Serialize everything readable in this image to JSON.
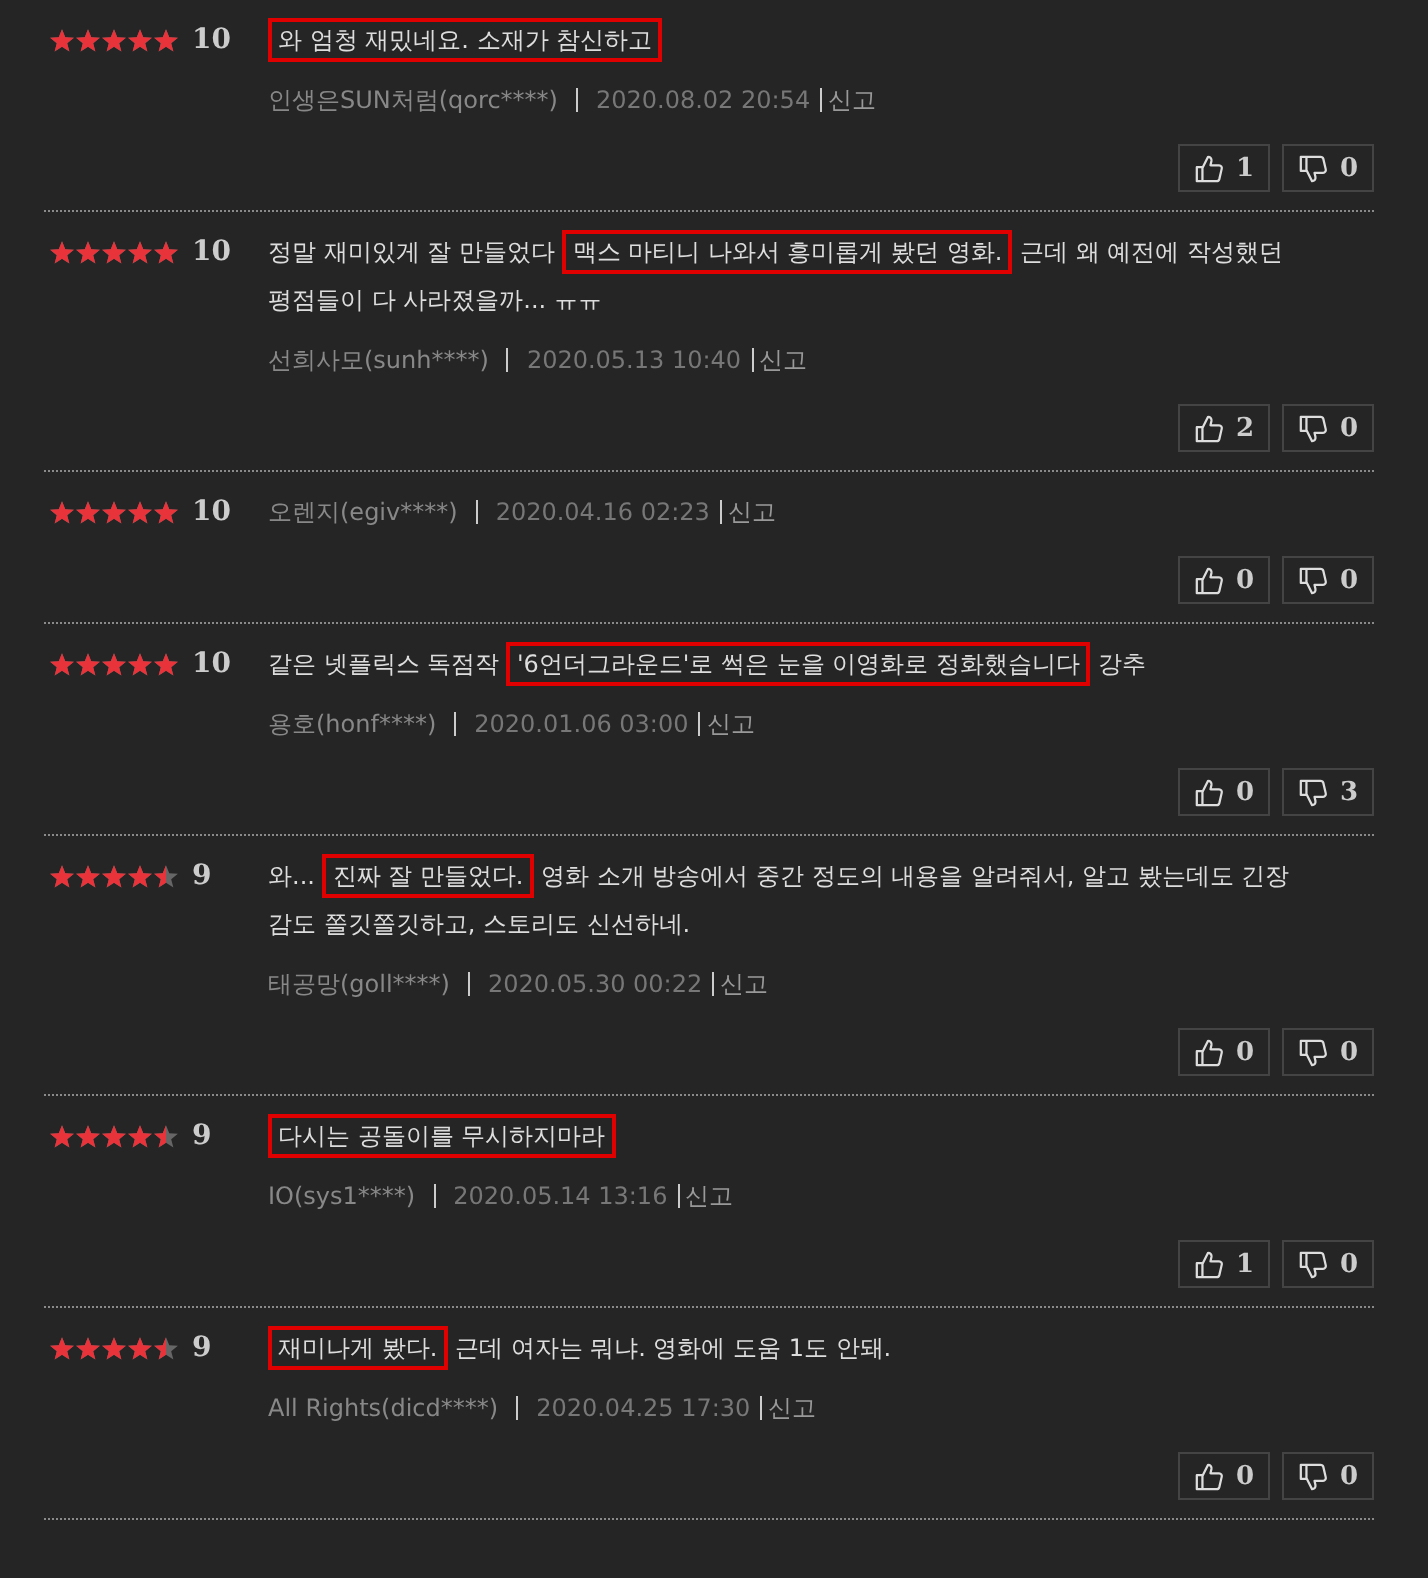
{
  "reviews": [
    {
      "stars": 5,
      "score": "10",
      "comment": [
        {
          "text": "와 엄청 재밌네요. 소재가 참신하고",
          "highlighted": true
        }
      ],
      "author": "인생은SUN처럼(qorc****)",
      "date": "2020.08.02 20:54",
      "report": "신고",
      "likes": "1",
      "dislikes": "0"
    },
    {
      "stars": 5,
      "score": "10",
      "comment": [
        {
          "text": "정말 재미있게 잘 만들었다 ",
          "highlighted": false
        },
        {
          "text": "맥스 마티니 나와서 흥미롭게 봤던 영화.",
          "highlighted": true
        },
        {
          "text": " 근데 왜 예전에 작성했던 평점들이 다 사라졌을까... ㅠㅠ",
          "highlighted": false
        }
      ],
      "author": "선희사모(sunh****)",
      "date": "2020.05.13 10:40",
      "report": "신고",
      "likes": "2",
      "dislikes": "0"
    },
    {
      "stars": 5,
      "score": "10",
      "author": "오렌지(egiv****)",
      "date": "2020.04.16 02:23",
      "report": "신고",
      "likes": "0",
      "dislikes": "0"
    },
    {
      "stars": 5,
      "score": "10",
      "comment": [
        {
          "text": "같은 넷플릭스 독점작 ",
          "highlighted": false
        },
        {
          "text": "'6언더그라운드'로 썩은 눈을 이영화로 정화했습니다",
          "highlighted": true
        },
        {
          "text": " 강추",
          "highlighted": false
        }
      ],
      "author": "용호(honf****)",
      "date": "2020.01.06 03:00",
      "report": "신고",
      "likes": "0",
      "dislikes": "3"
    },
    {
      "stars": 4.5,
      "score": "9",
      "comment": [
        {
          "text": "와... ",
          "highlighted": false
        },
        {
          "text": "진짜 잘 만들었다.",
          "highlighted": true
        },
        {
          "text": " 영화 소개 방송에서 중간 정도의 내용을 알려줘서, 알고 봤는데도 긴장감도 쫄깃쫄깃하고, 스토리도 신선하네.",
          "highlighted": false
        }
      ],
      "author": "태공망(goll****)",
      "date": "2020.05.30 00:22",
      "report": "신고",
      "likes": "0",
      "dislikes": "0"
    },
    {
      "stars": 4.5,
      "score": "9",
      "comment": [
        {
          "text": "다시는 공돌이를 무시하지마라",
          "highlighted": true
        }
      ],
      "author": "IO(sys1****)",
      "date": "2020.05.14 13:16",
      "report": "신고",
      "likes": "1",
      "dislikes": "0"
    },
    {
      "stars": 4.5,
      "score": "9",
      "comment": [
        {
          "text": "재미나게 봤다.",
          "highlighted": true
        },
        {
          "text": " 근데 여자는 뭐냐. 영화에 도움 1도 안돼.",
          "highlighted": false
        }
      ],
      "author": "All Rights(dicd****)",
      "date": "2020.04.25 17:30",
      "report": "신고",
      "likes": "0",
      "dislikes": "0"
    }
  ]
}
